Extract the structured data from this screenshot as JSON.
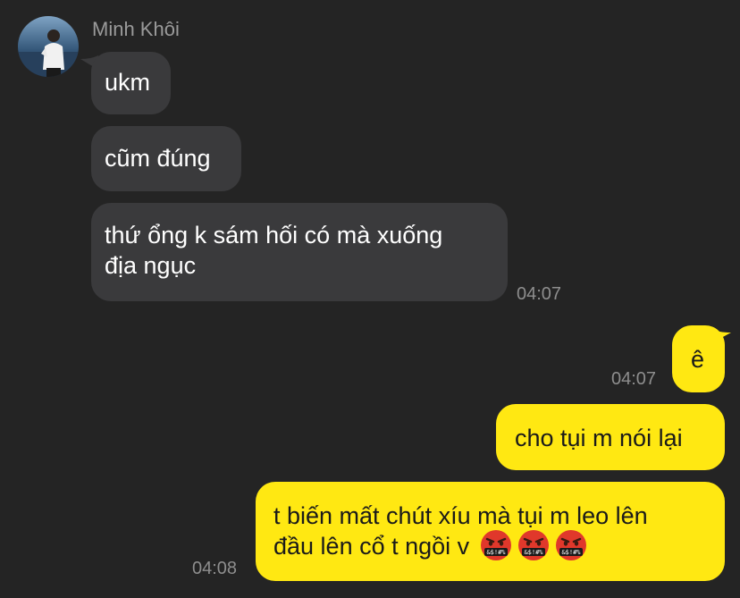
{
  "chat": {
    "sender_name": "Minh Khôi",
    "incoming": [
      {
        "text": "ukm"
      },
      {
        "text": "cũm đúng"
      },
      {
        "line1": "thứ ổng k sám hối có mà xuống",
        "line2": "địa ngục",
        "time": "04:07"
      }
    ],
    "outgoing": [
      {
        "text": "ê",
        "time": "04:07"
      },
      {
        "text": "cho tụi m nói lại"
      },
      {
        "line1": "t biến mất chút xíu mà tụi m leo lên",
        "line2": "đầu lên cổ t ngồi v",
        "time": "04:08",
        "emojis": [
          "angry-cursing-face-icon",
          "angry-cursing-face-icon",
          "angry-cursing-face-icon"
        ],
        "emoji_glyph": "&$!#%"
      }
    ]
  },
  "colors": {
    "background": "#242424",
    "incoming_bubble": "#3a3a3c",
    "outgoing_bubble": "#ffe812",
    "timestamp": "#8e8e8e"
  }
}
